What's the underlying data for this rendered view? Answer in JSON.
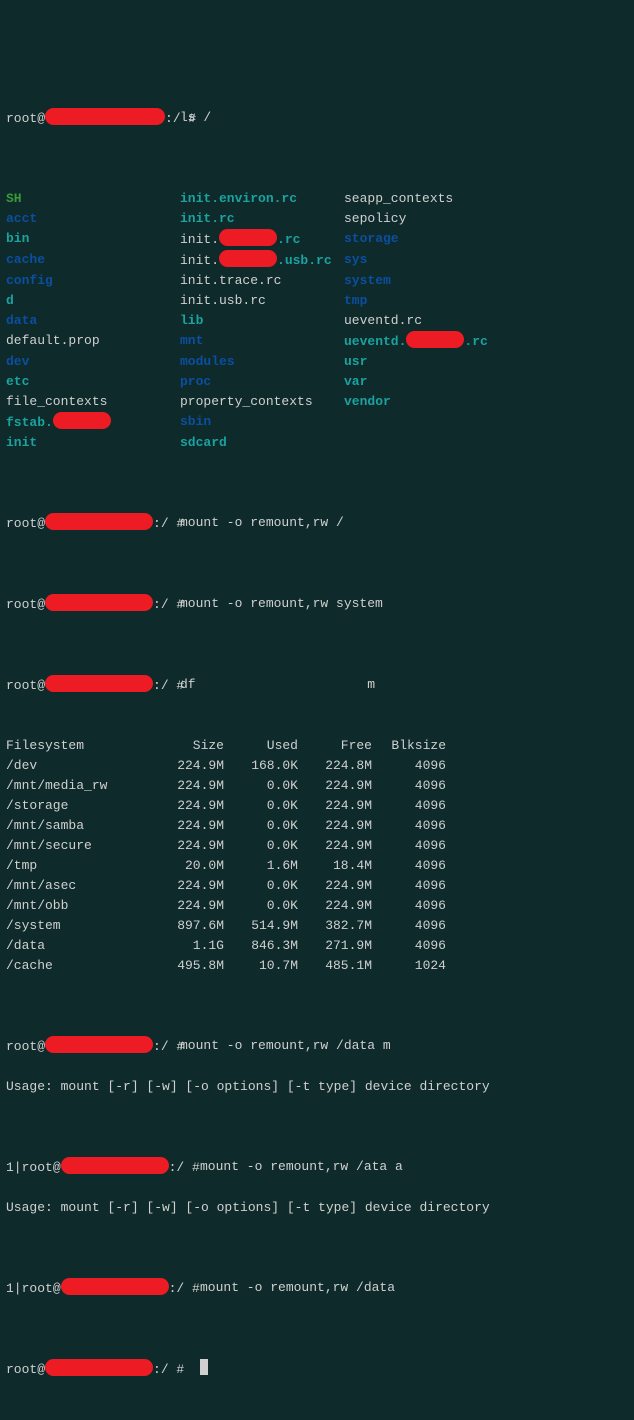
{
  "prompt": {
    "user": "root",
    "at": "@",
    "suffix_path": ":/ # ",
    "suffix_empty": ":/ #  "
  },
  "commands": {
    "ls": "ls /",
    "mount_root": "mount -o remount,rw /",
    "mount_system": "mount -o remount,rw system",
    "df": "df                      m",
    "mount_data_m": "mount -o remount,rw /data m",
    "mount_ata_a": "mount -o remount,rw /ata a",
    "mount_data": "mount -o remount,rw /data"
  },
  "usage": "Usage: mount [-r] [-w] [-o options] [-t type] device directory",
  "one_prefix": "1|root",
  "ls": {
    "rows": [
      {
        "c1": {
          "t": "SH",
          "cls": "g"
        },
        "c2": {
          "t": "init.environ.rc",
          "cls": "c"
        },
        "c3": {
          "t": "seapp_contexts",
          "cls": "w"
        }
      },
      {
        "c1": {
          "t": "acct",
          "cls": "b"
        },
        "c2": {
          "t": "init.rc",
          "cls": "c"
        },
        "c3": {
          "t": "sepolicy",
          "cls": "w"
        }
      },
      {
        "c1": {
          "t": "bin",
          "cls": "c"
        },
        "c2": {
          "t": "init.",
          "redact": "sm",
          "t2": ".rc",
          "cls2": "c"
        },
        "c3": {
          "t": "storage",
          "cls": "b"
        }
      },
      {
        "c1": {
          "t": "cache",
          "cls": "b"
        },
        "c2": {
          "t": "init.",
          "redact": "sm",
          "t2": ".usb.rc",
          "cls2": "c"
        },
        "c3": {
          "t": "sys",
          "cls": "b"
        }
      },
      {
        "c1": {
          "t": "config",
          "cls": "b"
        },
        "c2": {
          "t": "init.trace.rc",
          "cls": "w"
        },
        "c3": {
          "t": "system",
          "cls": "b"
        }
      },
      {
        "c1": {
          "t": "d",
          "cls": "c"
        },
        "c2": {
          "t": "init.usb.rc",
          "cls": "w"
        },
        "c3": {
          "t": "tmp",
          "cls": "b"
        }
      },
      {
        "c1": {
          "t": "data",
          "cls": "b"
        },
        "c2": {
          "t": "lib",
          "cls": "c"
        },
        "c3": {
          "t": "ueventd.rc",
          "cls": "w"
        }
      },
      {
        "c1": {
          "t": "default.prop",
          "cls": "w"
        },
        "c2": {
          "t": "mnt",
          "cls": "b"
        },
        "c3": {
          "t": "ueventd.",
          "redact": "sm",
          "t2": ".rc",
          "cls2": "c",
          "cls": "c"
        }
      },
      {
        "c1": {
          "t": "dev",
          "cls": "b"
        },
        "c2": {
          "t": "modules",
          "cls": "b"
        },
        "c3": {
          "t": "usr",
          "cls": "c"
        }
      },
      {
        "c1": {
          "t": "etc",
          "cls": "c"
        },
        "c2": {
          "t": "proc",
          "cls": "b"
        },
        "c3": {
          "t": "var",
          "cls": "c"
        }
      },
      {
        "c1": {
          "t": "file_contexts",
          "cls": "w"
        },
        "c2": {
          "t": "property_contexts",
          "cls": "w"
        },
        "c3": {
          "t": "vendor",
          "cls": "c"
        }
      },
      {
        "c1": {
          "t": "fstab.",
          "redact": "sm",
          "cls": "c"
        },
        "c2": {
          "t": "sbin",
          "cls": "b"
        },
        "c3": {
          "t": "",
          "cls": "w"
        }
      },
      {
        "c1": {
          "t": "init",
          "cls": "c"
        },
        "c2": {
          "t": "sdcard",
          "cls": "c"
        },
        "c3": {
          "t": "",
          "cls": "w"
        }
      }
    ]
  },
  "df": {
    "header": {
      "fs": "Filesystem",
      "sz": "Size",
      "us": "Used",
      "fr": "Free",
      "bk": "Blksize"
    },
    "rows": [
      {
        "fs": "/dev",
        "sz": "224.9M",
        "us": "168.0K",
        "fr": "224.8M",
        "bk": "4096"
      },
      {
        "fs": "/mnt/media_rw",
        "sz": "224.9M",
        "us": "0.0K",
        "fr": "224.9M",
        "bk": "4096"
      },
      {
        "fs": "/storage",
        "sz": "224.9M",
        "us": "0.0K",
        "fr": "224.9M",
        "bk": "4096"
      },
      {
        "fs": "/mnt/samba",
        "sz": "224.9M",
        "us": "0.0K",
        "fr": "224.9M",
        "bk": "4096"
      },
      {
        "fs": "/mnt/secure",
        "sz": "224.9M",
        "us": "0.0K",
        "fr": "224.9M",
        "bk": "4096"
      },
      {
        "fs": "/tmp",
        "sz": "20.0M",
        "us": "1.6M",
        "fr": "18.4M",
        "bk": "4096"
      },
      {
        "fs": "/mnt/asec",
        "sz": "224.9M",
        "us": "0.0K",
        "fr": "224.9M",
        "bk": "4096"
      },
      {
        "fs": "/mnt/obb",
        "sz": "224.9M",
        "us": "0.0K",
        "fr": "224.9M",
        "bk": "4096"
      },
      {
        "fs": "/system",
        "sz": "897.6M",
        "us": "514.9M",
        "fr": "382.7M",
        "bk": "4096"
      },
      {
        "fs": "/data",
        "sz": "1.1G",
        "us": "846.3M",
        "fr": "271.9M",
        "bk": "4096"
      },
      {
        "fs": "/cache",
        "sz": "495.8M",
        "us": "10.7M",
        "fr": "485.1M",
        "bk": "1024"
      }
    ]
  }
}
